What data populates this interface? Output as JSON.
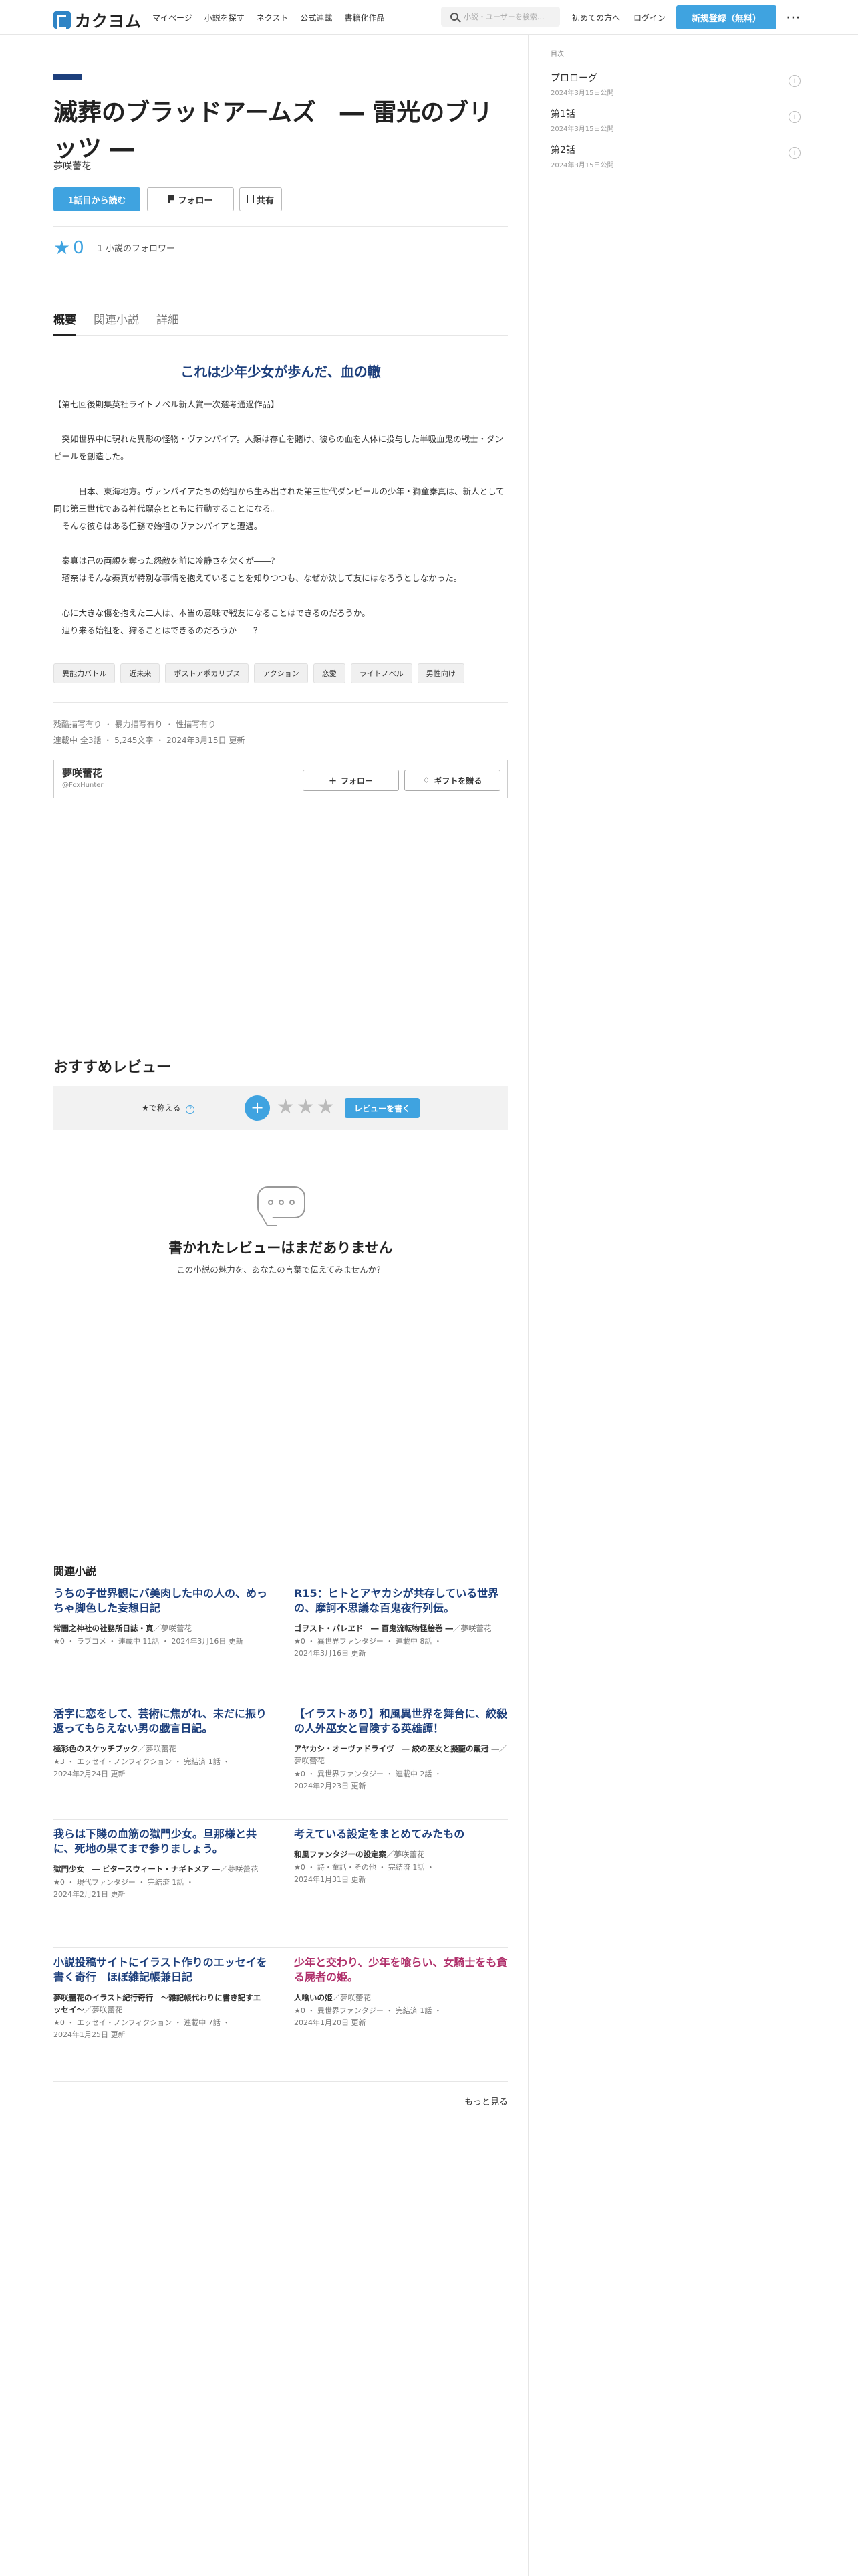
{
  "header": {
    "logo_text": "カクヨム",
    "nav": [
      "マイページ",
      "小説を探す",
      "ネクスト",
      "公式連載",
      "書籍化作品"
    ],
    "search_placeholder": "小説・ユーザーを検索…",
    "beginner_link": "初めての方へ",
    "login_link": "ログイン",
    "signup_button": "新規登録（無料）",
    "more_icon": "⋯"
  },
  "work": {
    "title": "滅葬のブラッドアームズ　― 雷光のブリッツ ―",
    "author": "夢咲蕾花",
    "read_button": "1話目から読む",
    "follow_button": "フォロー",
    "share_button": "共有",
    "star_icon": "★",
    "stars": "0",
    "followers": "1 小説のフォロワー"
  },
  "tabs": [
    "概要",
    "関連小説",
    "詳細"
  ],
  "summary": {
    "catchphrase": "これは少年少女が歩んだ、血の轍",
    "introduction": "【第七回後期集英社ライトノベル新人賞一次選考通過作品】\n\n　突如世界中に現れた異形の怪物・ヴァンパイア。人類は存亡を賭け、彼らの血を人体に投与した半吸血鬼の戦士・ダンピールを創造した。\n\n　――日本、東海地方。ヴァンパイアたちの始祖から生み出された第三世代ダンピールの少年・獅童秦真は、新人として同じ第三世代である神代瑠奈とともに行動することになる。\n　そんな彼らはある任務で始祖のヴァンパイアと遭遇。\n\n　秦真は己の両親を奪った怨敵を前に冷静さを欠くが――？\n　瑠奈はそんな秦真が特別な事情を抱えていることを知りつつも、なぜか決して友にはなろうとしなかった。\n\n　心に大きな傷を抱えた二人は、本当の意味で戦友になることはできるのだろうか。\n　辿り来る始祖を、狩ることはできるのだろうか――？",
    "tags": [
      "異能力バトル",
      "近未来",
      "ポストアポカリプス",
      "アクション",
      "恋愛",
      "ライトノベル",
      "男性向け"
    ],
    "content_warnings": "残酷描写有り ・ 暴力描写有り ・ 性描写有り",
    "status_line": "連載中 全3話 ・ 5,245文字 ・ 2024年3月15日 更新"
  },
  "author_box": {
    "name": "夢咲蕾花",
    "handle": "@FoxHunter",
    "follow_button": "フォロー",
    "gift_button": "ギフトを贈る"
  },
  "toc": {
    "label": "目次",
    "episodes": [
      {
        "title": "プロローグ",
        "date": "2024年3月15日公開"
      },
      {
        "title": "第1話",
        "date": "2024年3月15日公開"
      },
      {
        "title": "第2話",
        "date": "2024年3月15日公開"
      }
    ]
  },
  "reviews": {
    "heading": "おすすめレビュー",
    "rate_label": "★で称える",
    "plus_icon": "+",
    "star_icons": [
      "★",
      "★",
      "★"
    ],
    "write_button": "レビューを書く",
    "empty_title": "書かれたレビューはまだありません",
    "empty_sub": "この小説の魅力を、あなたの言葉で伝えてみませんか？"
  },
  "related": {
    "heading": "関連小説",
    "more_link": "もっと見る",
    "items": [
      {
        "title": "うちの子世界観にバ美肉した中の人の、めっちゃ脚色した妄想日記",
        "subtitle": "常闇之神社の社務所日誌・真",
        "by": "／夢咲蕾花",
        "meta1": "★0 ・ ラブコメ ・ 連載中 11話 ・ 2024年3月16日 更新",
        "meta2": "",
        "pink": false
      },
      {
        "title": "R15：ヒトとアヤカシが共存している世界の、摩訶不思議な百鬼夜行列伝。",
        "subtitle": "ゴヲスト・パレヱド　― 百鬼流転物怪絵巻 ―",
        "by": "／夢咲蕾花",
        "meta1": "★0 ・ 異世界ファンタジー ・ 連載中 8話 ・",
        "meta2": "2024年3月16日 更新",
        "pink": false
      },
      {
        "title": "活字に恋をして、芸術に焦がれ、未だに振り返ってもらえない男の戯言日記。",
        "subtitle": "極彩色のスケッチブック",
        "by": "／夢咲蕾花",
        "meta1": "★3 ・ エッセイ・ノンフィクション ・ 完結済 1話 ・",
        "meta2": "2024年2月24日 更新",
        "pink": false
      },
      {
        "title": "【イラストあり】和風異世界を舞台に、絞殺の人外巫女と冒険する英雄譚！",
        "subtitle": "アヤカシ・オーヴァドライヴ　― 絞の巫女と擬龍の戴冠 ―",
        "by": "／夢咲蕾花",
        "meta1": "★0 ・ 異世界ファンタジー ・ 連載中 2話 ・",
        "meta2": "2024年2月23日 更新",
        "pink": false
      },
      {
        "title": "我らは下賤の血筋の獄門少女。旦那様と共に、死地の果てまで参りましょう。",
        "subtitle": "獄門少女　― ビタースウィート・ナギトメア ―",
        "by": "／夢咲蕾花",
        "meta1": "★0 ・ 現代ファンタジー ・ 完結済 1話 ・",
        "meta2": "2024年2月21日 更新",
        "pink": false
      },
      {
        "title": "考えている設定をまとめてみたもの",
        "subtitle": "和風ファンタジーの設定案",
        "by": "／夢咲蕾花",
        "meta1": "★0 ・ 詩・童話・その他 ・ 完結済 1話 ・",
        "meta2": "2024年1月31日 更新",
        "pink": false
      },
      {
        "title": "小説投稿サイトにイラスト作りのエッセイを書く奇行　ほぼ雑記帳兼日記",
        "subtitle": "夢咲蕾花のイラスト紀行奇行　～雑記帳代わりに書き記すエッセイ～",
        "by": "／夢咲蕾花",
        "meta1": "★0 ・ エッセイ・ノンフィクション ・ 連載中 7話 ・",
        "meta2": "2024年1月25日 更新",
        "pink": false
      },
      {
        "title": "少年と交わり、少年を喰らい、女騎士をも貪る屍者の姫。",
        "subtitle": "人喰いの姫",
        "by": "／夢咲蕾花",
        "meta1": "★0 ・ 異世界ファンタジー ・ 完結済 1話 ・",
        "meta2": "2024年1月20日 更新",
        "pink": true
      }
    ]
  }
}
